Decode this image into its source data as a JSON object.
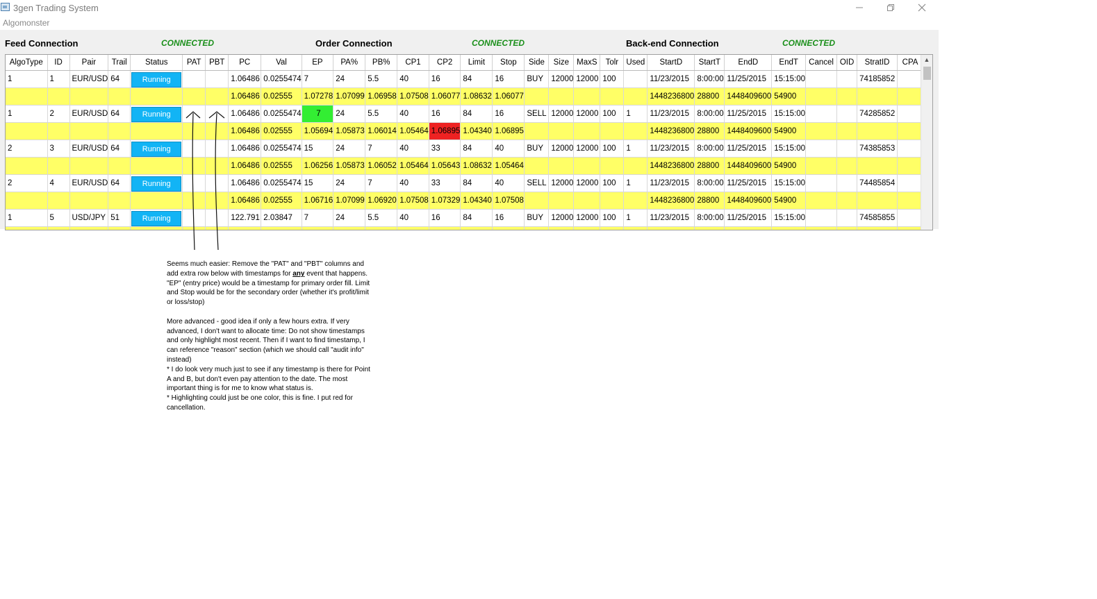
{
  "window": {
    "title": "3gen Trading System",
    "subtitle": "Algomonster",
    "minimize_icon": "minimize-icon",
    "maximize_icon": "restore-icon",
    "close_icon": "close-icon"
  },
  "connections": {
    "feed_label": "Feed Connection",
    "feed_status": "CONNECTED",
    "order_label": "Order Connection",
    "order_status": "CONNECTED",
    "backend_label": "Back-end Connection",
    "backend_status": "CONNECTED",
    "status_color": "#1a8f1a"
  },
  "grid": {
    "columns": [
      "AlgoType",
      "ID",
      "Pair",
      "Trail",
      "Status",
      "PAT",
      "PBT",
      "PC",
      "Val",
      "EP",
      "PA%",
      "PB%",
      "CP1",
      "CP2",
      "Limit",
      "Stop",
      "Side",
      "Size",
      "MaxS",
      "Tolr",
      "Used",
      "StartD",
      "StartT",
      "EndD",
      "EndT",
      "Cancel",
      "OID",
      "StratID",
      "CPA"
    ],
    "rows": [
      {
        "type": "main",
        "cells": [
          "1",
          "1",
          "EUR/USD",
          "64",
          "Running",
          "",
          "",
          "1.06486",
          "0.0255474",
          "7",
          "24",
          "5.5",
          "40",
          "16",
          "84",
          "16",
          "BUY",
          "12000",
          "12000",
          "100",
          "",
          "11/23/2015",
          "8:00:00",
          "11/25/2015",
          "15:15:00",
          "",
          "",
          "74185852",
          ""
        ]
      },
      {
        "type": "sub",
        "cells": [
          "",
          "",
          "",
          "",
          "",
          "",
          "",
          "1.06486",
          "0.02555",
          "1.07278",
          "1.07099",
          "1.06958",
          "1.07508",
          "1.06077",
          "1.08632",
          "1.06077",
          "",
          "",
          "",
          "",
          "",
          "1448236800",
          "28800",
          "1448409600",
          "54900",
          "",
          "",
          "",
          ""
        ]
      },
      {
        "type": "main",
        "cells": [
          "1",
          "2",
          "EUR/USD",
          "64",
          "Running",
          "",
          "",
          "1.06486",
          "0.0255474",
          "7",
          "24",
          "5.5",
          "40",
          "16",
          "84",
          "16",
          "SELL",
          "12000",
          "12000",
          "100",
          "1",
          "11/23/2015",
          "8:00:00",
          "11/25/2015",
          "15:15:00",
          "",
          "",
          "74285852",
          ""
        ]
      },
      {
        "type": "sub",
        "cells": [
          "",
          "",
          "",
          "",
          "",
          "",
          "",
          "1.06486",
          "0.02555",
          "1.05694",
          "1.05873",
          "1.06014",
          "1.05464",
          "1.06895",
          "1.04340",
          "1.06895",
          "",
          "",
          "",
          "",
          "",
          "1448236800",
          "28800",
          "1448409600",
          "54900",
          "",
          "",
          "",
          ""
        ]
      },
      {
        "type": "main",
        "cells": [
          "2",
          "3",
          "EUR/USD",
          "64",
          "Running",
          "",
          "",
          "1.06486",
          "0.0255474",
          "15",
          "24",
          "7",
          "40",
          "33",
          "84",
          "40",
          "BUY",
          "12000",
          "12000",
          "100",
          "1",
          "11/23/2015",
          "8:00:00",
          "11/25/2015",
          "15:15:00",
          "",
          "",
          "74385853",
          ""
        ]
      },
      {
        "type": "sub",
        "cells": [
          "",
          "",
          "",
          "",
          "",
          "",
          "",
          "1.06486",
          "0.02555",
          "1.06256",
          "1.05873",
          "1.06052",
          "1.05464",
          "1.05643",
          "1.08632",
          "1.05464",
          "",
          "",
          "",
          "",
          "",
          "1448236800",
          "28800",
          "1448409600",
          "54900",
          "",
          "",
          "",
          ""
        ]
      },
      {
        "type": "main",
        "cells": [
          "2",
          "4",
          "EUR/USD",
          "64",
          "Running",
          "",
          "",
          "1.06486",
          "0.0255474",
          "15",
          "24",
          "7",
          "40",
          "33",
          "84",
          "40",
          "SELL",
          "12000",
          "12000",
          "100",
          "1",
          "11/23/2015",
          "8:00:00",
          "11/25/2015",
          "15:15:00",
          "",
          "",
          "74485854",
          ""
        ]
      },
      {
        "type": "sub",
        "cells": [
          "",
          "",
          "",
          "",
          "",
          "",
          "",
          "1.06486",
          "0.02555",
          "1.06716",
          "1.07099",
          "1.06920",
          "1.07508",
          "1.07329",
          "1.04340",
          "1.07508",
          "",
          "",
          "",
          "",
          "",
          "1448236800",
          "28800",
          "1448409600",
          "54900",
          "",
          "",
          "",
          ""
        ]
      },
      {
        "type": "main",
        "cells": [
          "1",
          "5",
          "USD/JPY",
          "51",
          "Running",
          "",
          "",
          "122.791",
          "2.03847",
          "7",
          "24",
          "5.5",
          "40",
          "16",
          "84",
          "16",
          "BUY",
          "12000",
          "12000",
          "100",
          "1",
          "11/23/2015",
          "8:00:00",
          "11/25/2015",
          "15:15:00",
          "",
          "",
          "74585855",
          ""
        ]
      },
      {
        "type": "sub",
        "cells": [
          "",
          "",
          "",
          "",
          "",
          "",
          "",
          "",
          "",
          "",
          "",
          "",
          "",
          "",
          "",
          "",
          "",
          "",
          "",
          "",
          "",
          "",
          "",
          "",
          "",
          "",
          "",
          "",
          ""
        ]
      }
    ],
    "highlights": [
      {
        "row": 2,
        "col": 9,
        "color": "#33ee33"
      },
      {
        "row": 3,
        "col": 13,
        "color": "#ee2222"
      }
    ],
    "running_color": "#12b4f5",
    "sub_row_color": "#ffff66",
    "scroll_up_icon": "chevron-up-icon"
  },
  "annotation": {
    "p1a": "Seems much easier: Remove the \"PAT\" and \"PBT\" columns and add extra row below with timestamps for ",
    "p1b": "any",
    "p1c": " event that happens. \"EP\" (entry price) would be a timestamp for primary order fill. Limit and Stop would be for the secondary order (whether it's profit/limit or loss/stop)",
    "p2": "More advanced - good idea if only a few hours extra. If very advanced, I don't want to allocate time: Do not show timestamps and only highlight most recent. Then if I want to find timestamp, I can reference \"reason\" section (which we should call \"audit info\" instead)",
    "p3": "* I do look very much just to see if any timestamp is there for Point A and B, but don't even pay attention to the date. The most important thing is for me to know what status is.",
    "p4": "* Highlighting could just be one color, this is fine. I put red for cancellation."
  }
}
